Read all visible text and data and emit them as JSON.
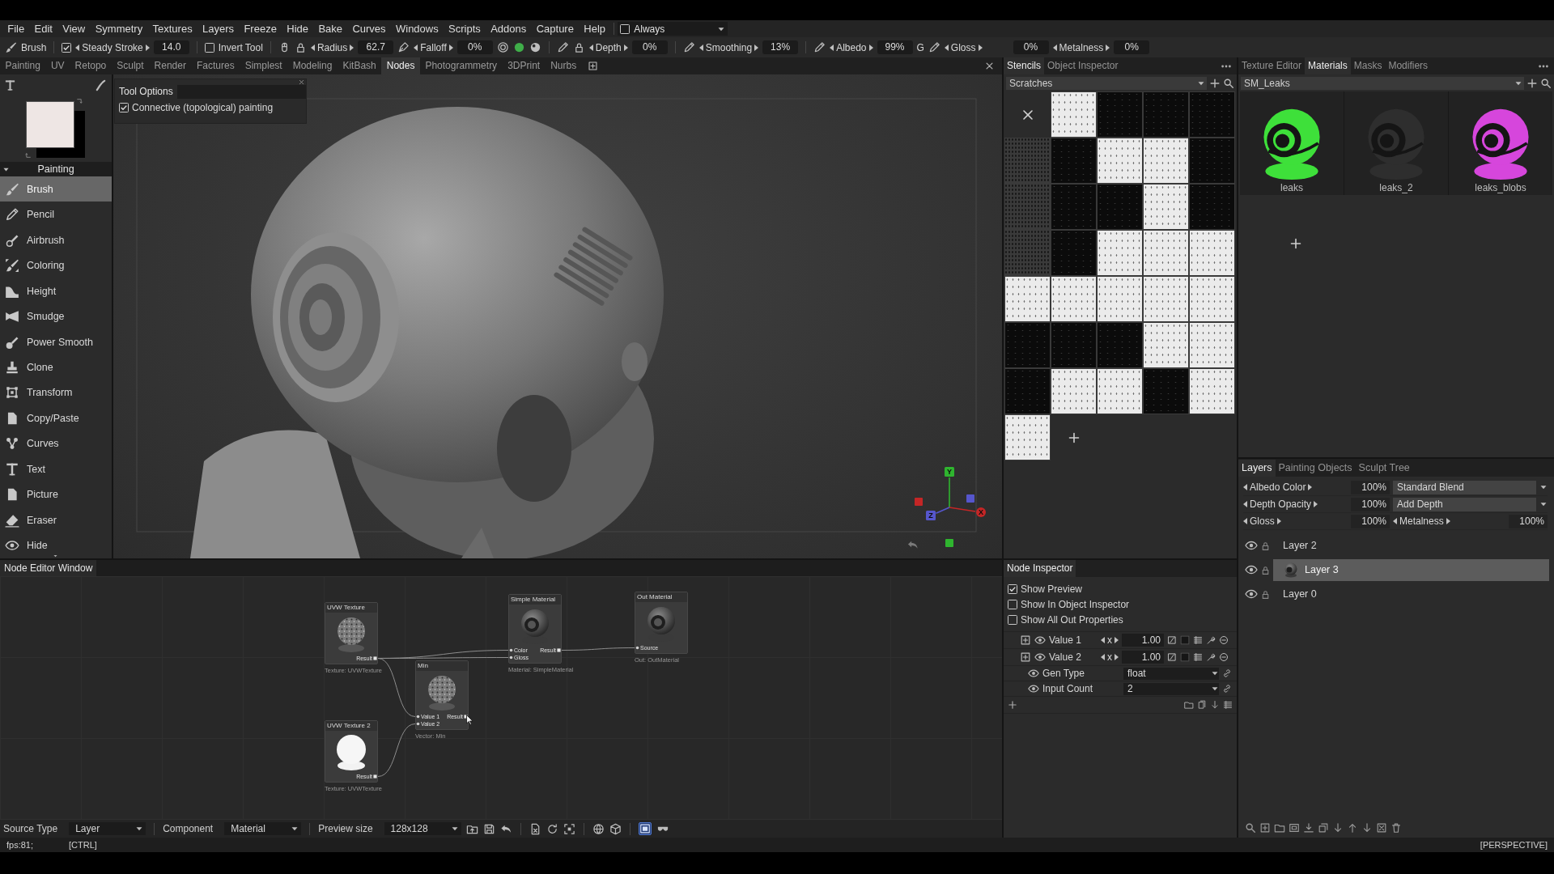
{
  "menu_bar": {
    "items": [
      "File",
      "Edit",
      "View",
      "Symmetry",
      "Textures",
      "Layers",
      "Freeze",
      "Hide",
      "Bake",
      "Curves",
      "Windows",
      "Scripts",
      "Addons",
      "Capture",
      "Help"
    ],
    "mode_toggle": {
      "label": "Always",
      "checked": false
    }
  },
  "toolbar": {
    "tool": "Brush",
    "steady_stroke": {
      "label": "Steady Stroke",
      "checked": true,
      "value": "14.0"
    },
    "invert_tool": {
      "label": "Invert Tool",
      "checked": false
    },
    "radius": {
      "label": "Radius",
      "value": "62.7"
    },
    "falloff": {
      "label": "Falloff",
      "value": "0%"
    },
    "depth": {
      "label": "Depth",
      "value": "0%"
    },
    "smoothing": {
      "label": "Smoothing",
      "value": "13%"
    },
    "albedo": {
      "label": "Albedo",
      "value": "99%",
      "channel": "G"
    },
    "gloss": {
      "label": "Gloss",
      "value": "0%"
    },
    "metalness": {
      "label": "Metalness",
      "value": "0%"
    }
  },
  "workspace_tabs": [
    {
      "label": "Painting",
      "selected": false
    },
    {
      "label": "UV",
      "selected": false
    },
    {
      "label": "Retopo",
      "selected": false
    },
    {
      "label": "Sculpt",
      "selected": false
    },
    {
      "label": "Render",
      "selected": false
    },
    {
      "label": "Factures",
      "selected": false
    },
    {
      "label": "Simplest",
      "selected": false
    },
    {
      "label": "Modeling",
      "selected": false
    },
    {
      "label": "KitBash",
      "selected": false
    },
    {
      "label": "Nodes",
      "selected": true
    },
    {
      "label": "Photogrammetry",
      "selected": false
    },
    {
      "label": "3DPrint",
      "selected": false
    },
    {
      "label": "Nurbs",
      "selected": false
    }
  ],
  "tool_panel": {
    "color_swatches": [
      {
        "color": "#eee6e4"
      },
      {
        "color": "#000000"
      }
    ],
    "section": "Painting",
    "tools": [
      {
        "label": "Brush",
        "selected": true
      },
      {
        "label": "Pencil",
        "selected": false
      },
      {
        "label": "Airbrush",
        "selected": false
      },
      {
        "label": "Coloring",
        "selected": false
      },
      {
        "label": "Height",
        "selected": false
      },
      {
        "label": "Smudge",
        "selected": false
      },
      {
        "label": "Power Smooth",
        "selected": false
      },
      {
        "label": "Clone",
        "selected": false
      },
      {
        "label": "Transform",
        "selected": false
      },
      {
        "label": "Copy/Paste",
        "selected": false
      },
      {
        "label": "Curves",
        "selected": false
      },
      {
        "label": "Text",
        "selected": false
      },
      {
        "label": "Picture",
        "selected": false
      },
      {
        "label": "Eraser",
        "selected": false
      },
      {
        "label": "Hide",
        "selected": false
      }
    ]
  },
  "tool_options": {
    "title": "Tool Options",
    "options": [
      {
        "label": "Connective (topological) painting",
        "checked": true
      }
    ]
  },
  "viewport": {
    "axes": [
      {
        "label": "Y",
        "color": "#2fb52f"
      },
      {
        "label": "Z",
        "color": "#5656cc"
      },
      {
        "label": "X",
        "color": "#c42626"
      }
    ]
  },
  "node_editor": {
    "title": "Node Editor Window",
    "nodes": [
      {
        "title": "UVW Texture",
        "kind": "texture",
        "outputs": [
          "Result"
        ],
        "subtitle": "Texture: UVWTexture"
      },
      {
        "title": "Min",
        "kind": "texture",
        "inputs": [
          "Value 1",
          "Value 2"
        ],
        "outputs": [
          "Result"
        ],
        "subtitle": "Vector: Min"
      },
      {
        "title": "Simple Material",
        "kind": "material",
        "inputs": [
          "Color",
          "Gloss"
        ],
        "outputs": [
          "Result"
        ],
        "subtitle": "Material: SimpleMaterial"
      },
      {
        "title": "Out Material",
        "kind": "material",
        "inputs": [
          "Source"
        ],
        "subtitle": "Out: OutMaterial"
      },
      {
        "title": "UVW Texture 2",
        "kind": "mask",
        "outputs": [
          "Result"
        ],
        "subtitle": "Texture: UVWTexture"
      }
    ],
    "source_type": {
      "label": "Source Type",
      "value": "Layer"
    },
    "component": {
      "label": "Component",
      "value": "Material"
    },
    "preview_size": {
      "label": "Preview size",
      "value": "128x128"
    },
    "view_toggles": [
      {
        "selected": true
      },
      {
        "selected": false
      }
    ]
  },
  "stencils_panel": {
    "tabs": [
      {
        "label": "Stencils",
        "selected": true
      },
      {
        "label": "Object Inspector",
        "selected": false
      }
    ],
    "library": "Scratches",
    "stencils": [
      {
        "kind": "light"
      },
      {
        "kind": "dark"
      },
      {
        "kind": "dark"
      },
      {
        "kind": "dark"
      },
      {
        "kind": "gray"
      },
      {
        "kind": "dark"
      },
      {
        "kind": "light"
      },
      {
        "kind": "light"
      },
      {
        "kind": "dark"
      },
      {
        "kind": "gray"
      },
      {
        "kind": "dark"
      },
      {
        "kind": "dark"
      },
      {
        "kind": "light"
      },
      {
        "kind": "dark"
      },
      {
        "kind": "gray"
      },
      {
        "kind": "dark"
      },
      {
        "kind": "light"
      },
      {
        "kind": "light"
      },
      {
        "kind": "light"
      },
      {
        "kind": "light"
      },
      {
        "kind": "light"
      },
      {
        "kind": "light"
      },
      {
        "kind": "light"
      },
      {
        "kind": "light"
      },
      {
        "kind": "dark"
      },
      {
        "kind": "dark"
      },
      {
        "kind": "dark"
      },
      {
        "kind": "light"
      },
      {
        "kind": "light"
      },
      {
        "kind": "dark"
      },
      {
        "kind": "light"
      },
      {
        "kind": "light"
      },
      {
        "kind": "dark"
      },
      {
        "kind": "light"
      },
      {
        "kind": "light"
      }
    ]
  },
  "materials_panel": {
    "tabs": [
      {
        "label": "Texture Editor",
        "selected": false
      },
      {
        "label": "Materials",
        "selected": true
      },
      {
        "label": "Masks",
        "selected": false
      },
      {
        "label": "Modifiers",
        "selected": false
      }
    ],
    "library": "SM_Leaks",
    "materials": [
      {
        "label": "leaks",
        "color": "#3ee03a"
      },
      {
        "label": "leaks_2",
        "color": "#2e2e2e"
      },
      {
        "label": "leaks_blobs",
        "color": "#d646dc"
      }
    ]
  },
  "node_inspector": {
    "title": "Node Inspector",
    "options": [
      {
        "label": "Show Preview",
        "checked": true
      },
      {
        "label": "Show In Object Inspector",
        "checked": false
      },
      {
        "label": "Show All Out Properties",
        "checked": false
      }
    ],
    "properties": [
      {
        "kind": "value",
        "label": "Value 1",
        "axis": "x",
        "value": "1.00"
      },
      {
        "kind": "value",
        "label": "Value 2",
        "axis": "x",
        "value": "1.00"
      },
      {
        "kind": "dropdown",
        "label": "Gen Type",
        "value": "float"
      },
      {
        "kind": "dropdown",
        "label": "Input Count",
        "value": "2"
      }
    ]
  },
  "layers_panel": {
    "tabs": [
      {
        "label": "Layers",
        "selected": true
      },
      {
        "label": "Painting Objects",
        "selected": false
      },
      {
        "label": "Sculpt Tree",
        "selected": false
      }
    ],
    "channels": [
      {
        "kind": "blend",
        "label": "Albedo Color",
        "value": "100%",
        "blend": "Standard Blend"
      },
      {
        "kind": "blend",
        "label": "Depth Opacity",
        "value": "100%",
        "blend": "Add Depth"
      },
      {
        "kind": "pair",
        "label": "Gloss",
        "value": "100%",
        "second_label": "Metalness",
        "second_value": "100%"
      }
    ],
    "layers": [
      {
        "name": "Layer 2",
        "selected": false,
        "thumbnail": false
      },
      {
        "name": "Layer 3",
        "selected": true,
        "thumbnail": true
      },
      {
        "name": "Layer 0",
        "selected": false,
        "thumbnail": false
      }
    ]
  },
  "status_bar": {
    "fps": "fps:81;",
    "modifier": "[CTRL]",
    "view": "[PERSPECTIVE]"
  }
}
